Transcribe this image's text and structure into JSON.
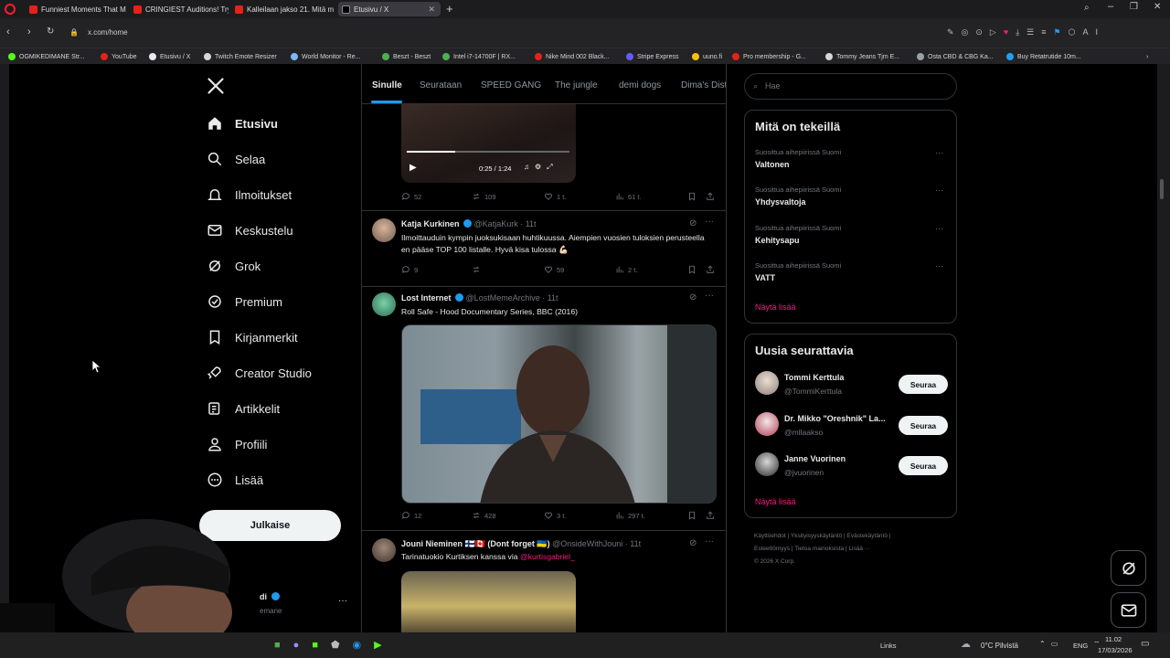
{
  "browser": {
    "tabs": [
      {
        "label": "Funniest Moments That M",
        "color": "#e62117"
      },
      {
        "label": "CRINGIEST Auditions! Try",
        "color": "#e62117"
      },
      {
        "label": "Kalleilaan jakso 21. Mitä m",
        "color": "#e62117"
      },
      {
        "label": "Etusivu / X",
        "color": "#e7e9ea"
      }
    ],
    "url": "x.com/home",
    "bookmarks": [
      {
        "label": "OGMIKEDIMANE Str...",
        "color": "#53fc18"
      },
      {
        "label": "YouTube",
        "color": "#e62117"
      },
      {
        "label": "Etusivu / X",
        "color": "#e7e9ea"
      },
      {
        "label": "Twitch Emote Resizer",
        "color": "#d6d6d6"
      },
      {
        "label": "World Monitor - Re...",
        "color": "#7bb7ff"
      },
      {
        "label": "Beszt - Beszt",
        "color": "#4caf50"
      },
      {
        "label": "Intel i7-14700F | RX...",
        "color": "#4caf50"
      },
      {
        "label": "Nike Mind 002 Black...",
        "color": "#e62117"
      },
      {
        "label": "Stripe Express",
        "color": "#635bff"
      },
      {
        "label": "uuno.fi",
        "color": "#f4c20d"
      },
      {
        "label": "Pro membership - G...",
        "color": "#e62117"
      },
      {
        "label": "Tommy Jeans Tjm E...",
        "color": "#d6d6d6"
      },
      {
        "label": "Osta CBD & CBG Ka...",
        "color": "#9aa0a6"
      },
      {
        "label": "Buy Retatrutide 10m...",
        "color": "#1da1f2"
      }
    ]
  },
  "nav": {
    "logo": "X",
    "items": [
      {
        "label": "Etusivu",
        "icon": "home-icon"
      },
      {
        "label": "Selaa",
        "icon": "search-icon"
      },
      {
        "label": "Ilmoitukset",
        "icon": "bell-icon"
      },
      {
        "label": "Keskustelu",
        "icon": "mail-icon"
      },
      {
        "label": "Grok",
        "icon": "grok-icon"
      },
      {
        "label": "Premium",
        "icon": "premium-icon"
      },
      {
        "label": "Kirjanmerkit",
        "icon": "bookmark-icon"
      },
      {
        "label": "Creator Studio",
        "icon": "rocket-icon"
      },
      {
        "label": "Artikkelit",
        "icon": "article-icon"
      },
      {
        "label": "Profiili",
        "icon": "person-icon"
      },
      {
        "label": "Lisää",
        "icon": "more-circle-icon"
      }
    ],
    "post_label": "Julkaise",
    "account_name": "di",
    "account_handle": "emane"
  },
  "feed_tabs": [
    "Sinulle",
    "Seurataan",
    "SPEED GANG",
    "The jungle",
    "demi dogs",
    "Dima's Dist"
  ],
  "tweets": [
    {
      "video_time": "0:25 / 1:24",
      "replies": "52",
      "reposts": "109",
      "likes": "1 t.",
      "views": "61 t."
    },
    {
      "name": "Katja Kurkinen",
      "handle": "@KatjaKurk · 11t",
      "text": "Ilmoittauduin kympin juoksukisaan huhtikuussa. Aiempien vuosien tuloksien perusteella en pääse TOP 100 listalle. Hyvä kisa tulossa 💪🏻",
      "replies": "9",
      "reposts": "",
      "likes": "59",
      "views": "2 t."
    },
    {
      "name": "Lost Internet",
      "handle": "@LostMemeArchive · 11t",
      "text": "Roll Safe - Hood Documentary Series, BBC (2016)",
      "replies": "12",
      "reposts": "428",
      "likes": "3 t.",
      "views": "297 t."
    },
    {
      "name": "Jouni Nieminen 🇫🇮🇨🇦 (Dont forget 🇺🇦)",
      "handle": "@OnsideWithJouni · 11t",
      "text": "Tarinatuokio Kurtiksen kanssa via ",
      "mention": "@kurtisgabriel_"
    }
  ],
  "search_placeholder": "Hae",
  "trends": {
    "title": "Mitä on tekeillä",
    "items": [
      {
        "context": "Suosittua aihepiirissä Suomi",
        "name": "Valtonen"
      },
      {
        "context": "Suosittua aihepiirissä Suomi",
        "name": "Yhdysvaltoja"
      },
      {
        "context": "Suosittua aihepiirissä Suomi",
        "name": "Kehitysapu"
      },
      {
        "context": "Suosittua aihepiirissä Suomi",
        "name": "VATT"
      }
    ],
    "show_more": "Näytä lisää"
  },
  "who_to_follow": {
    "title": "Uusia seurattavia",
    "items": [
      {
        "name": "Tommi Kerttula",
        "handle": "@TommiKerttula",
        "button": "Seuraa"
      },
      {
        "name": "Dr. Mikko \"Oreshnik\" La...",
        "handle": "@mllaakso",
        "button": "Seuraa"
      },
      {
        "name": "Janne Vuorinen",
        "handle": "@jvuorinen",
        "button": "Seuraa"
      }
    ],
    "show_more": "Näytä lisää"
  },
  "footer": {
    "line1": "Käyttöehdot  |  Yksityisyyskäytäntö  |  Evästekäytäntö  |",
    "line2": "Esteettömyys  |  Tietoa mainoksista  |  Lisää ···",
    "line3": "© 2026 X Corp."
  },
  "taskbar": {
    "links": "Links",
    "weather": "0°C  Pilvistä",
    "lang": "ENG",
    "time": "11.02",
    "date": "17/03/2026"
  },
  "colors": {
    "accent_blue": "#1d9bf0",
    "pink": "#f91880",
    "bg": "#000000"
  }
}
